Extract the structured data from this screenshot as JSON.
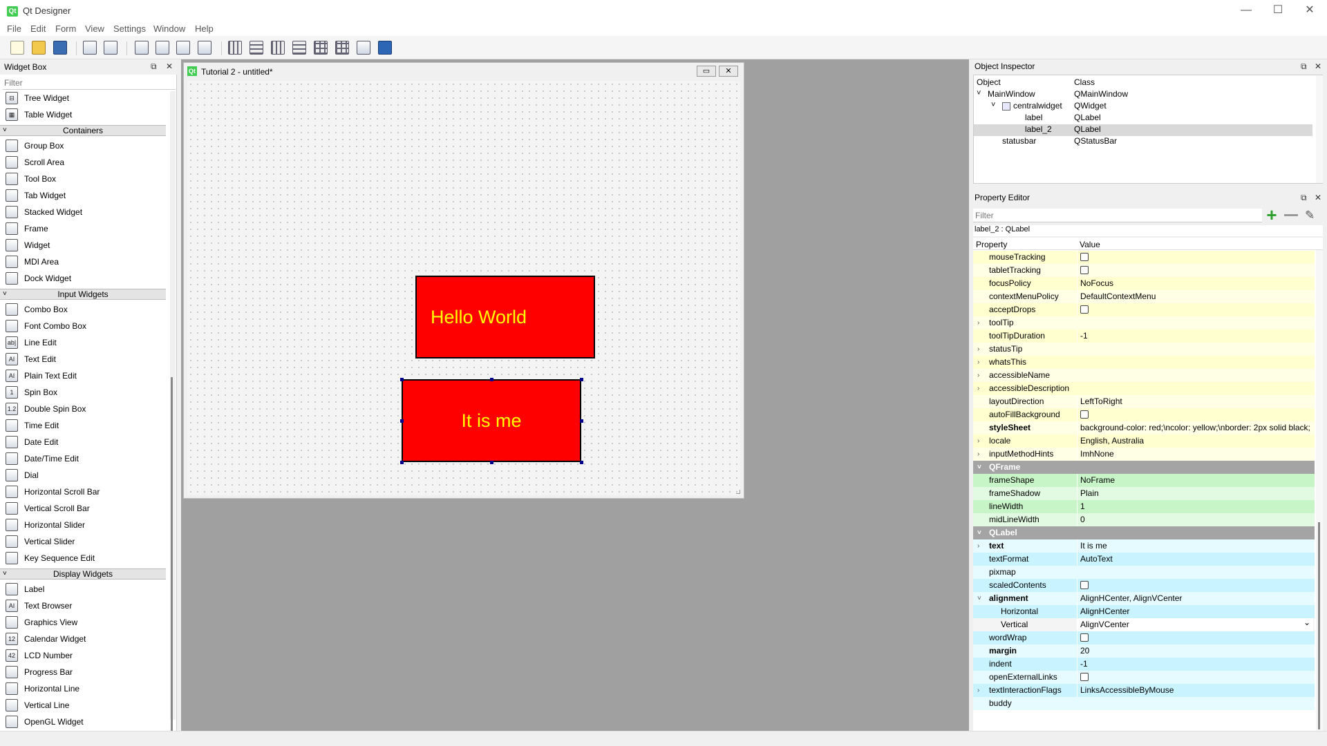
{
  "window": {
    "title": "Qt Designer",
    "icon": "qt-logo",
    "minimize": "—",
    "maximize": "☐",
    "close": "✕"
  },
  "menubar": [
    "File",
    "Edit",
    "Form",
    "View",
    "Settings",
    "Window",
    "Help"
  ],
  "widget_box": {
    "title": "Widget Box",
    "filter_placeholder": "Filter",
    "float": "⧉",
    "close": "✕",
    "list": [
      {
        "type": "item",
        "label": "Tree Widget",
        "icon": "tree-widget-icon",
        "glyph": "⊟"
      },
      {
        "type": "item",
        "label": "Table Widget",
        "icon": "table-widget-icon",
        "glyph": "▦"
      },
      {
        "type": "cat",
        "label": "Containers"
      },
      {
        "type": "item",
        "label": "Group Box",
        "icon": "group-box-icon",
        "glyph": ""
      },
      {
        "type": "item",
        "label": "Scroll Area",
        "icon": "scroll-area-icon",
        "glyph": ""
      },
      {
        "type": "item",
        "label": "Tool Box",
        "icon": "tool-box-icon",
        "glyph": ""
      },
      {
        "type": "item",
        "label": "Tab Widget",
        "icon": "tab-widget-icon",
        "glyph": ""
      },
      {
        "type": "item",
        "label": "Stacked Widget",
        "icon": "stacked-widget-icon",
        "glyph": ""
      },
      {
        "type": "item",
        "label": "Frame",
        "icon": "frame-icon",
        "glyph": ""
      },
      {
        "type": "item",
        "label": "Widget",
        "icon": "widget-icon",
        "glyph": ""
      },
      {
        "type": "item",
        "label": "MDI Area",
        "icon": "mdi-area-icon",
        "glyph": ""
      },
      {
        "type": "item",
        "label": "Dock Widget",
        "icon": "dock-widget-icon",
        "glyph": ""
      },
      {
        "type": "cat",
        "label": "Input Widgets"
      },
      {
        "type": "item",
        "label": "Combo Box",
        "icon": "combo-box-icon",
        "glyph": ""
      },
      {
        "type": "item",
        "label": "Font Combo Box",
        "icon": "font-combo-box-icon",
        "glyph": ""
      },
      {
        "type": "item",
        "label": "Line Edit",
        "icon": "line-edit-icon",
        "glyph": "ab|"
      },
      {
        "type": "item",
        "label": "Text Edit",
        "icon": "text-edit-icon",
        "glyph": "AI"
      },
      {
        "type": "item",
        "label": "Plain Text Edit",
        "icon": "plain-text-edit-icon",
        "glyph": "AI"
      },
      {
        "type": "item",
        "label": "Spin Box",
        "icon": "spin-box-icon",
        "glyph": "1"
      },
      {
        "type": "item",
        "label": "Double Spin Box",
        "icon": "double-spin-box-icon",
        "glyph": "1.2"
      },
      {
        "type": "item",
        "label": "Time Edit",
        "icon": "time-edit-icon",
        "glyph": ""
      },
      {
        "type": "item",
        "label": "Date Edit",
        "icon": "date-edit-icon",
        "glyph": ""
      },
      {
        "type": "item",
        "label": "Date/Time Edit",
        "icon": "date-time-edit-icon",
        "glyph": ""
      },
      {
        "type": "item",
        "label": "Dial",
        "icon": "dial-icon",
        "glyph": ""
      },
      {
        "type": "item",
        "label": "Horizontal Scroll Bar",
        "icon": "horizontal-scroll-bar-icon",
        "glyph": ""
      },
      {
        "type": "item",
        "label": "Vertical Scroll Bar",
        "icon": "vertical-scroll-bar-icon",
        "glyph": ""
      },
      {
        "type": "item",
        "label": "Horizontal Slider",
        "icon": "horizontal-slider-icon",
        "glyph": ""
      },
      {
        "type": "item",
        "label": "Vertical Slider",
        "icon": "vertical-slider-icon",
        "glyph": ""
      },
      {
        "type": "item",
        "label": "Key Sequence Edit",
        "icon": "key-sequence-edit-icon",
        "glyph": ""
      },
      {
        "type": "cat",
        "label": "Display Widgets"
      },
      {
        "type": "item",
        "label": "Label",
        "icon": "label-icon",
        "glyph": ""
      },
      {
        "type": "item",
        "label": "Text Browser",
        "icon": "text-browser-icon",
        "glyph": "AI"
      },
      {
        "type": "item",
        "label": "Graphics View",
        "icon": "graphics-view-icon",
        "glyph": ""
      },
      {
        "type": "item",
        "label": "Calendar Widget",
        "icon": "calendar-widget-icon",
        "glyph": "12"
      },
      {
        "type": "item",
        "label": "LCD Number",
        "icon": "lcd-number-icon",
        "glyph": "42"
      },
      {
        "type": "item",
        "label": "Progress Bar",
        "icon": "progress-bar-icon",
        "glyph": ""
      },
      {
        "type": "item",
        "label": "Horizontal Line",
        "icon": "horizontal-line-icon",
        "glyph": ""
      },
      {
        "type": "item",
        "label": "Vertical Line",
        "icon": "vertical-line-icon",
        "glyph": ""
      },
      {
        "type": "item",
        "label": "OpenGL Widget",
        "icon": "opengl-widget-icon",
        "glyph": ""
      }
    ]
  },
  "form": {
    "title": "Tutorial 2 - untitled*",
    "minimize": "▭",
    "close": "✕",
    "labels": [
      {
        "name": "label",
        "text": "Hello World"
      },
      {
        "name": "label_2",
        "text": "It is me"
      }
    ],
    "label_style": {
      "background": "#ff0000",
      "color": "#ffff00",
      "border": "#000000"
    }
  },
  "object_inspector": {
    "title": "Object Inspector",
    "columns": [
      "Object",
      "Class"
    ],
    "rows": [
      {
        "object": "MainWindow",
        "class": "QMainWindow",
        "level": 0,
        "expand": "˅"
      },
      {
        "object": "centralwidget",
        "class": "QWidget",
        "level": 1,
        "expand": "˅"
      },
      {
        "object": "label",
        "class": "QLabel",
        "level": 2,
        "expand": ""
      },
      {
        "object": "label_2",
        "class": "QLabel",
        "level": 2,
        "expand": "",
        "selected": true
      },
      {
        "object": "statusbar",
        "class": "QStatusBar",
        "level": 1,
        "expand": ""
      }
    ]
  },
  "property_editor": {
    "title": "Property Editor",
    "filter_placeholder": "Filter",
    "context": "label_2 : QLabel",
    "columns": [
      "Property",
      "Value"
    ],
    "rows": [
      {
        "p": "mouseTracking",
        "v": "",
        "cb": true,
        "bg": "#ffffd0"
      },
      {
        "p": "tabletTracking",
        "v": "",
        "cb": true,
        "bg": "#ffffe6"
      },
      {
        "p": "focusPolicy",
        "v": "NoFocus",
        "bg": "#ffffd0"
      },
      {
        "p": "contextMenuPolicy",
        "v": "DefaultContextMenu",
        "bg": "#ffffe6"
      },
      {
        "p": "acceptDrops",
        "v": "",
        "cb": true,
        "bg": "#ffffd0"
      },
      {
        "p": "toolTip",
        "v": "",
        "exp": "›",
        "bg": "#ffffe6"
      },
      {
        "p": "toolTipDuration",
        "v": "-1",
        "bg": "#ffffd0"
      },
      {
        "p": "statusTip",
        "v": "",
        "exp": "›",
        "bg": "#ffffe6"
      },
      {
        "p": "whatsThis",
        "v": "",
        "exp": "›",
        "bg": "#ffffd0"
      },
      {
        "p": "accessibleName",
        "v": "",
        "exp": "›",
        "bg": "#ffffe6"
      },
      {
        "p": "accessibleDescription",
        "v": "",
        "exp": "›",
        "bg": "#ffffd0"
      },
      {
        "p": "layoutDirection",
        "v": "LeftToRight",
        "bg": "#ffffe6"
      },
      {
        "p": "autoFillBackground",
        "v": "",
        "cb": true,
        "bg": "#ffffd0"
      },
      {
        "p": "styleSheet",
        "v": "background-color: red;\\ncolor: yellow;\\nborder: 2px solid black;",
        "bold": true,
        "bg": "#ffffe6"
      },
      {
        "p": "locale",
        "v": "English, Australia",
        "exp": "›",
        "bg": "#ffffd0"
      },
      {
        "p": "inputMethodHints",
        "v": "ImhNone",
        "exp": "›",
        "bg": "#ffffe6"
      },
      {
        "p": "QFrame",
        "v": "",
        "section": true,
        "exp": "˅"
      },
      {
        "p": "frameShape",
        "v": "NoFrame",
        "bg": "#c8f5c8"
      },
      {
        "p": "frameShadow",
        "v": "Plain",
        "bg": "#e2fae2"
      },
      {
        "p": "lineWidth",
        "v": "1",
        "bg": "#c8f5c8"
      },
      {
        "p": "midLineWidth",
        "v": "0",
        "bg": "#e2fae2"
      },
      {
        "p": "QLabel",
        "v": "",
        "section": true,
        "exp": "˅"
      },
      {
        "p": "text",
        "v": "It is me",
        "bold": true,
        "exp": "›",
        "bg": "#e6fbff"
      },
      {
        "p": "textFormat",
        "v": "AutoText",
        "bg": "#c8f3ff"
      },
      {
        "p": "pixmap",
        "v": "",
        "bg": "#e6fbff"
      },
      {
        "p": "scaledContents",
        "v": "",
        "cb": true,
        "bg": "#c8f3ff"
      },
      {
        "p": "alignment",
        "v": "AlignHCenter, AlignVCenter",
        "bold": true,
        "exp": "˅",
        "bg": "#e6fbff"
      },
      {
        "p": "Horizontal",
        "v": "AlignHCenter",
        "indent": true,
        "bg": "#c8f3ff"
      },
      {
        "p": "Vertical",
        "v": "AlignVCenter",
        "indent": true,
        "dropdown": true,
        "bg": "#e6fbff",
        "current": true
      },
      {
        "p": "wordWrap",
        "v": "",
        "cb": true,
        "bg": "#c8f3ff"
      },
      {
        "p": "margin",
        "v": "20",
        "bold": true,
        "bg": "#e6fbff"
      },
      {
        "p": "indent",
        "v": "-1",
        "bg": "#c8f3ff"
      },
      {
        "p": "openExternalLinks",
        "v": "",
        "cb": true,
        "bg": "#e6fbff"
      },
      {
        "p": "textInteractionFlags",
        "v": "LinksAccessibleByMouse",
        "exp": "›",
        "bg": "#c8f3ff"
      },
      {
        "p": "buddy",
        "v": "",
        "bg": "#e6fbff"
      }
    ]
  },
  "toolbar_icons": [
    "new-form-icon",
    "open-form-icon",
    "save-form-icon",
    "send-to-back-icon",
    "bring-to-front-icon",
    "edit-widgets-icon",
    "edit-signals-slots-icon",
    "edit-buddies-icon",
    "edit-tab-order-icon",
    "layout-horizontal-icon",
    "layout-vertical-icon",
    "layout-horizontal-splitter-icon",
    "layout-vertical-splitter-icon",
    "layout-grid-icon",
    "layout-form-icon",
    "break-layout-icon",
    "adjust-size-icon"
  ],
  "colors": {
    "qt_green": "#41cd52",
    "selection": "#d9d9d9",
    "section": "#a4a4a4"
  }
}
